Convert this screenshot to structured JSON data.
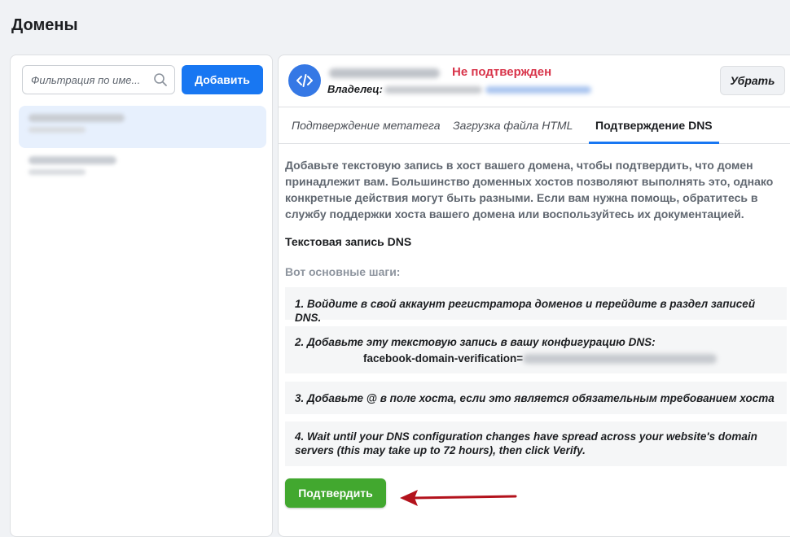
{
  "page": {
    "title": "Домены"
  },
  "sidebar": {
    "filter_placeholder": "Фильтрация по име...",
    "add_label": "Добавить"
  },
  "detail": {
    "status": "Не подтвержден",
    "owner_label": "Владелец:",
    "remove_label": "Убрать",
    "tabs": [
      {
        "label": "Подтверждение метатега"
      },
      {
        "label": "Загрузка файла HTML"
      },
      {
        "label": "Подтверждение DNS"
      }
    ],
    "instructions": "Добавьте текстовую запись в хост вашего домена, чтобы подтвердить, что домен принадлежит вам. Большинство доменных хостов позволяют выполнять это, однако конкретные действия могут быть разными. Если вам нужна помощь, обратитесь в службу поддержки хоста вашего домена или воспользуйтесь их документацией.",
    "section_title": "Текстовая запись DNS",
    "steps_intro": "Вот основные шаги:",
    "steps": [
      "1. Войдите в свой аккаунт регистратора доменов и перейдите в раздел записей DNS.",
      "2. Добавьте эту текстовую запись в вашу конфигурацию DNS:",
      "3. Добавьте @ в поле хоста, если это является обязательным требованием хоста",
      "4. Wait until your DNS configuration changes have spread across your website's domain servers (this may take up to 72 hours), then click Verify."
    ],
    "record_prefix": "facebook-domain-verification=",
    "verify_label": "Подтвердить"
  },
  "colors": {
    "accent": "#1877f2",
    "status": "#d8344a",
    "verify": "#42a82f",
    "arrow": "#b3121c"
  }
}
